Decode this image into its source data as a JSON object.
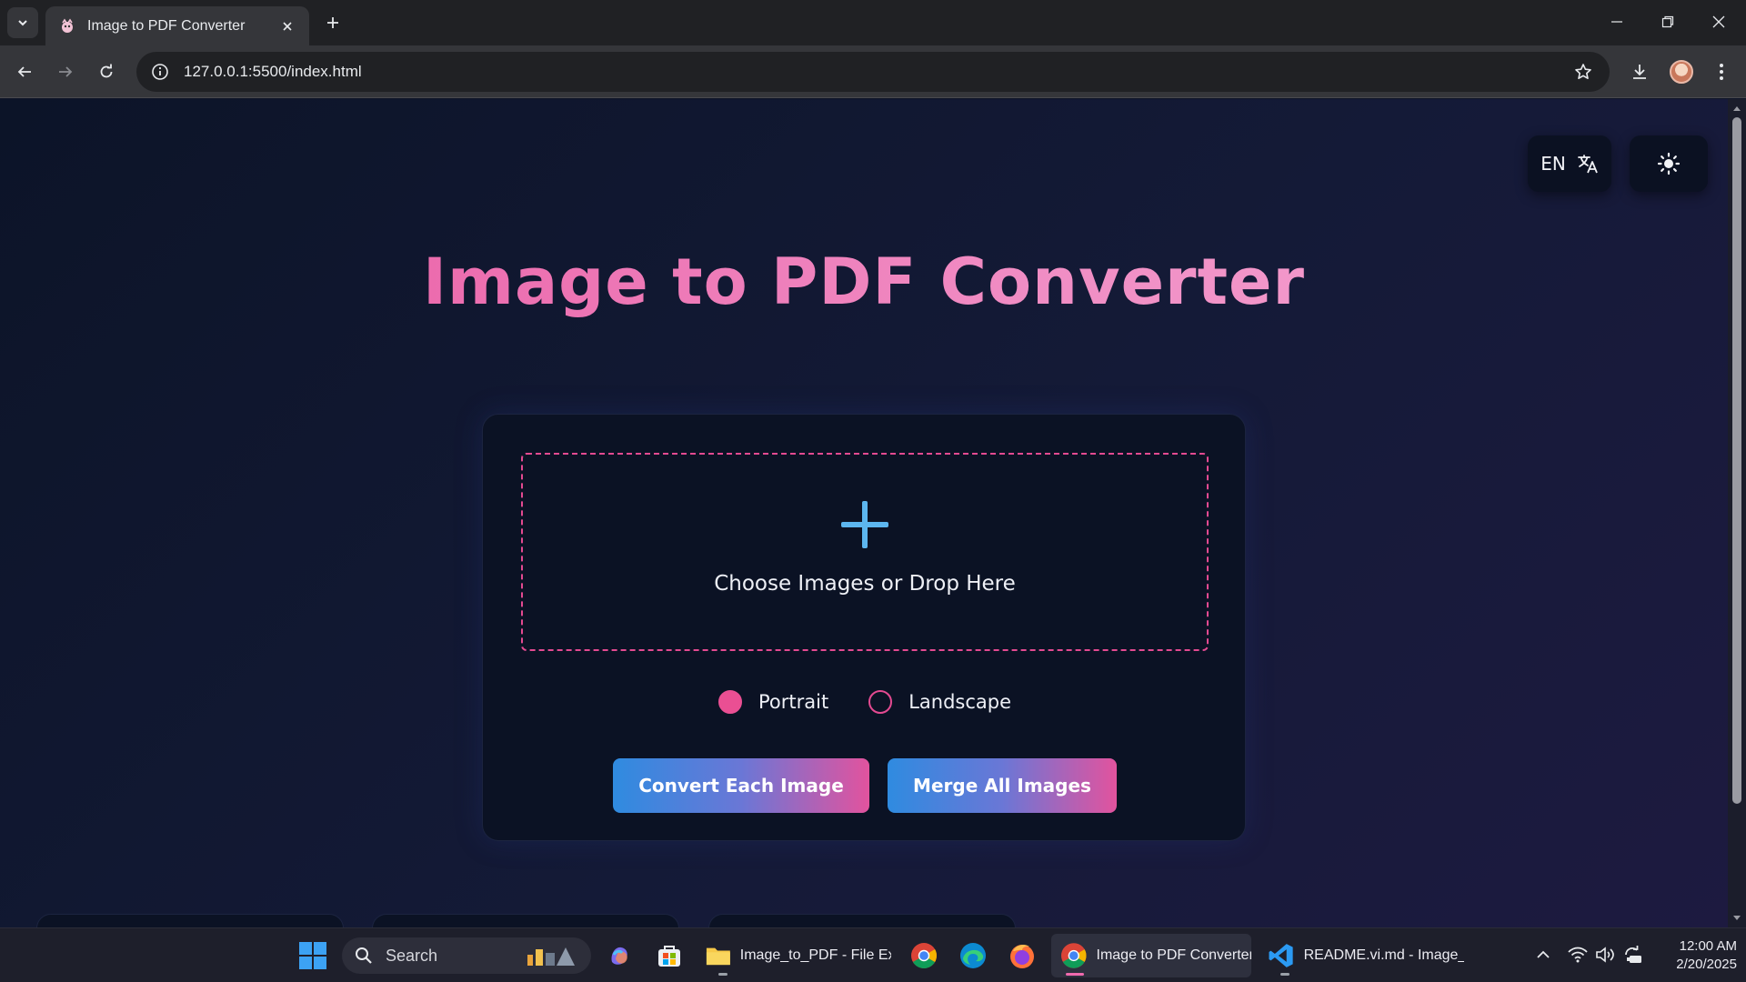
{
  "browser": {
    "tab_title": "Image to PDF Converter",
    "url": "127.0.0.1:5500/index.html"
  },
  "page": {
    "language_label": "EN",
    "title": "Image to PDF Converter",
    "dropzone_label": "Choose Images or Drop Here",
    "orientation": {
      "selected": "Portrait",
      "options": [
        "Portrait",
        "Landscape"
      ]
    },
    "convert_button": "Convert Each Image",
    "merge_button": "Merge All Images"
  },
  "colors": {
    "accent_pink": "#e44a91",
    "accent_blue": "#5cb6ef",
    "background": "#0d1326"
  },
  "taskbar": {
    "search_label": "Search",
    "apps": [
      {
        "label": "Image_to_PDF - File Exp",
        "icon": "folder-icon"
      },
      {
        "label": "",
        "icon": "chrome-icon"
      },
      {
        "label": "",
        "icon": "edge-icon"
      },
      {
        "label": "",
        "icon": "firefox-icon"
      },
      {
        "label": "Image to PDF Converter",
        "icon": "chrome-icon"
      },
      {
        "label": "README.vi.md - Image_",
        "icon": "vscode-icon"
      }
    ],
    "time": "12:00 AM",
    "date": "2/20/2025"
  }
}
